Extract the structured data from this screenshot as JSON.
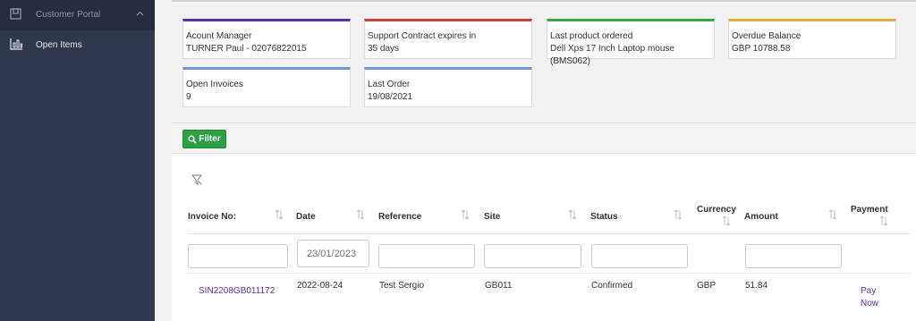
{
  "sidebar": {
    "portal_label": "Customer Portal",
    "open_items_label": "Open Items"
  },
  "colors": {
    "sidebar": "#30384d",
    "accent_purple": "#5b2ea6",
    "accent_red": "#c9413c",
    "accent_green": "#38a845",
    "accent_yellow": "#e3b23c",
    "accent_blue": "#6e98d1",
    "filter_green": "#2ea043"
  },
  "cards": [
    {
      "title": "Acount Manager",
      "value": "TURNER Paul - 02076822015"
    },
    {
      "title": "Support Contract expires in",
      "value": "35 days"
    },
    {
      "title": "Last product ordered",
      "value": "Dell Xps 17 Inch Laptop mouse (BMS062)"
    },
    {
      "title": "Overdue Balance",
      "value": "GBP 10788.58"
    },
    {
      "title": "Open Invoices",
      "value": "9"
    },
    {
      "title": "Last Order",
      "value": "19/08/2021"
    }
  ],
  "toolbar": {
    "filter_label": "Filter"
  },
  "table": {
    "columns": {
      "invoice": "Invoice No:",
      "date": "Date",
      "reference": "Reference",
      "site": "Site",
      "status": "Status",
      "currency": "Currency",
      "amount": "Amount",
      "payment": "Payment"
    },
    "date_filter_placeholder": "23/01/2023",
    "rows": [
      {
        "invoice": "SIN2208GB011172",
        "date": "2022-08-24",
        "reference": "Test Sergio",
        "site": "GB011",
        "status": "Confirmed",
        "currency": "GBP",
        "amount": "51.84",
        "payment_line1": "Pay",
        "payment_line2": "Now"
      }
    ]
  }
}
